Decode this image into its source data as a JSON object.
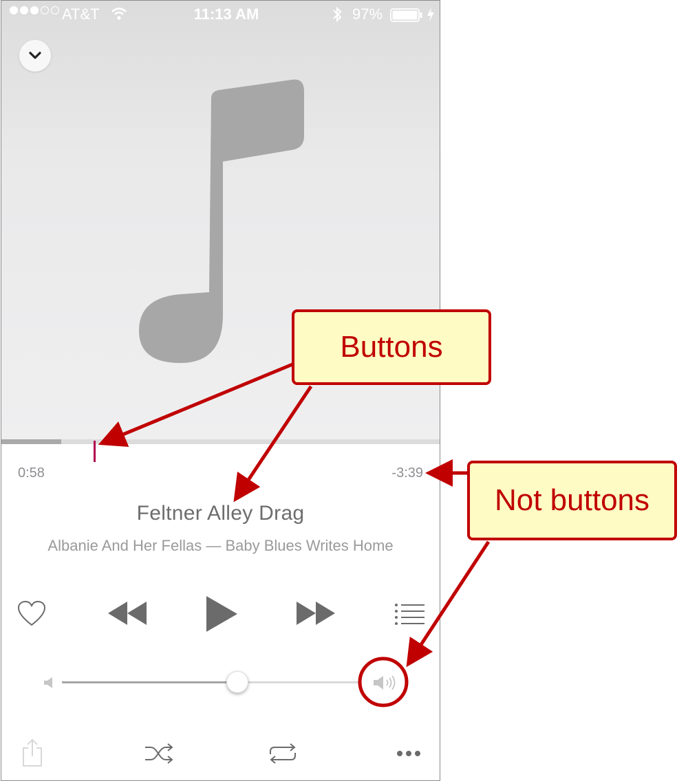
{
  "status_bar": {
    "carrier": "AT&T",
    "time": "11:13 AM",
    "battery_percent": "97%",
    "signal_bars_filled": 3,
    "signal_bars_total": 5
  },
  "now_playing": {
    "elapsed": "0:58",
    "remaining": "-3:39",
    "progress_fraction": 0.21,
    "title": "Feltner Alley Drag",
    "subtitle": "Albanie And Her Fellas — Baby Blues Writes Home",
    "volume_fraction": 0.59
  },
  "icons": {
    "dismiss": "chevron-down-icon",
    "artwork": "music-note-icon",
    "love": "heart-icon",
    "rewind": "rewind-icon",
    "play": "play-icon",
    "forward": "fast-forward-icon",
    "up_next": "list-icon",
    "volume_min": "speaker-low-icon",
    "volume_max": "speaker-high-icon",
    "share": "share-icon",
    "shuffle": "shuffle-icon",
    "repeat": "repeat-icon",
    "more": "more-icon"
  },
  "annotations": {
    "buttons_label": "Buttons",
    "not_buttons_label": "Not buttons"
  },
  "colors": {
    "scrub_handle": "#b0004d",
    "annotation_red": "#c00000",
    "annotation_fill": "#fefbc4",
    "controls_gray": "#6b6b6b"
  }
}
